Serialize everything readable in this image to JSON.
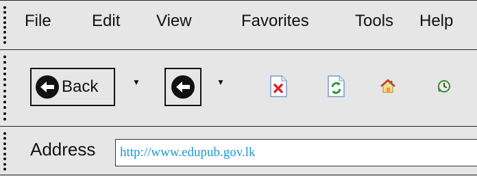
{
  "menu": {
    "items": [
      "File",
      "Edit",
      "View",
      "Favorites",
      "Tools",
      "Help"
    ]
  },
  "toolbar": {
    "back_label": "Back",
    "back_icon": "back-arrow-icon",
    "forward_icon": "forward-arrow-icon",
    "tools": [
      "stop-icon",
      "refresh-icon",
      "home-icon",
      "history-icon"
    ],
    "colors": {
      "stop": "#d9262b",
      "refresh": "#2a9a3a",
      "home": "#f0a020",
      "history": "#3a8a3a"
    }
  },
  "address": {
    "label": "Address",
    "url": "http://www.edupub.gov.lk"
  }
}
